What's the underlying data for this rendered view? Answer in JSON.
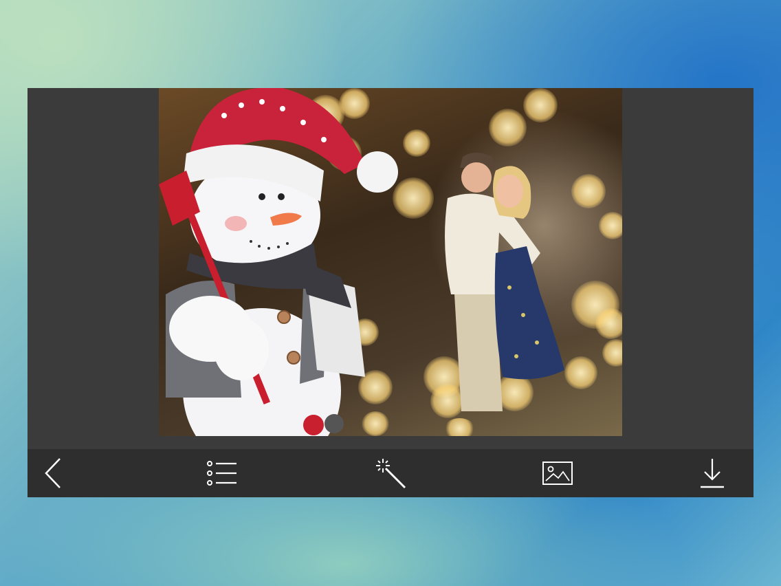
{
  "editor": {
    "photo_description_icon": "photo-frame-image",
    "toolbar": [
      {
        "name": "back-button",
        "icon": "chevron-left-icon"
      },
      {
        "name": "frames-list-button",
        "icon": "list-icon"
      },
      {
        "name": "effects-button",
        "icon": "magic-wand-icon"
      },
      {
        "name": "gallery-button",
        "icon": "image-icon"
      },
      {
        "name": "download-button",
        "icon": "download-icon"
      }
    ]
  },
  "colors": {
    "panel": "#3b3b3b",
    "toolbar": "#2e2e2e",
    "icon": "#ffffff"
  }
}
